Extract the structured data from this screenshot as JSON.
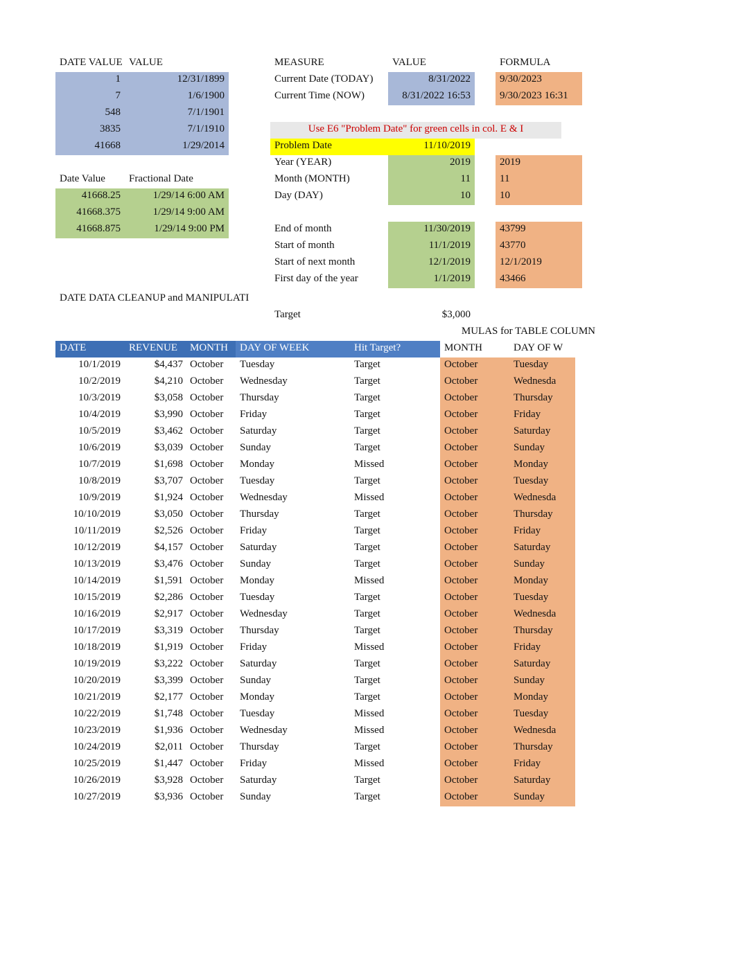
{
  "top_left": {
    "headers": [
      "DATE VALUE",
      "VALUE"
    ],
    "rows": [
      {
        "a": "1",
        "b": "12/31/1899"
      },
      {
        "a": "7",
        "b": "1/6/1900"
      },
      {
        "a": "548",
        "b": "7/1/1901"
      },
      {
        "a": "3835",
        "b": "7/1/1910"
      },
      {
        "a": "41668",
        "b": "1/29/2014"
      }
    ]
  },
  "frac": {
    "headers": [
      "Date Value",
      "Fractional Date"
    ],
    "rows": [
      {
        "a": "41668.25",
        "b": "1/29/14 6:00 AM"
      },
      {
        "a": "41668.375",
        "b": "1/29/14 9:00 AM"
      },
      {
        "a": "41668.875",
        "b": "1/29/14 9:00 PM"
      }
    ]
  },
  "top_right": {
    "headers": [
      "MEASURE",
      "VALUE",
      "FORMULA"
    ],
    "rows": [
      {
        "m": "Current Date (TODAY)",
        "v": "8/31/2022",
        "f": "9/30/2023"
      },
      {
        "m": "Current Time (NOW)",
        "v": "8/31/2022 16:53",
        "f": "9/30/2023 16:31"
      }
    ],
    "note": "Use E6 \"Problem Date\" for green cells in col. E & I",
    "problem_label": "Problem Date",
    "problem_value": "11/10/2019",
    "calc": [
      {
        "m": "Year (YEAR)",
        "v": "2019",
        "f": "2019"
      },
      {
        "m": "Month (MONTH)",
        "v": "11",
        "f": "11"
      },
      {
        "m": "Day (DAY)",
        "v": "10",
        "f": "10"
      }
    ],
    "calc2": [
      {
        "m": "End of month",
        "v": "11/30/2019",
        "f": "43799"
      },
      {
        "m": "Start of month",
        "v": "11/1/2019",
        "f": "43770"
      },
      {
        "m": "Start of next month",
        "v": "12/1/2019",
        "f": "12/1/2019"
      },
      {
        "m": "First day of the year",
        "v": "1/1/2019",
        "f": "43466"
      }
    ]
  },
  "cleanup_title": "DATE DATA CLEANUP and MANIPULATI",
  "target_label": "Target",
  "target_value": "$3,000",
  "mulas_label": "MULAS for TABLE COLUMN",
  "table": {
    "headers": [
      "DATE",
      "REVENUE",
      "MONTH",
      "DAY OF WEEK",
      "Hit Target?",
      "MONTH",
      "DAY OF W"
    ],
    "rows": [
      {
        "date": "10/1/2019",
        "rev": "$4,437",
        "mon": "October",
        "dow": "Tuesday",
        "hit": "Target",
        "mon2": "October",
        "dow2": "Tuesday"
      },
      {
        "date": "10/2/2019",
        "rev": "$4,210",
        "mon": "October",
        "dow": "Wednesday",
        "hit": "Target",
        "mon2": "October",
        "dow2": "Wednesda"
      },
      {
        "date": "10/3/2019",
        "rev": "$3,058",
        "mon": "October",
        "dow": "Thursday",
        "hit": "Target",
        "mon2": "October",
        "dow2": "Thursday"
      },
      {
        "date": "10/4/2019",
        "rev": "$3,990",
        "mon": "October",
        "dow": "Friday",
        "hit": "Target",
        "mon2": "October",
        "dow2": "Friday"
      },
      {
        "date": "10/5/2019",
        "rev": "$3,462",
        "mon": "October",
        "dow": "Saturday",
        "hit": "Target",
        "mon2": "October",
        "dow2": "Saturday"
      },
      {
        "date": "10/6/2019",
        "rev": "$3,039",
        "mon": "October",
        "dow": "Sunday",
        "hit": "Target",
        "mon2": "October",
        "dow2": "Sunday"
      },
      {
        "date": "10/7/2019",
        "rev": "$1,698",
        "mon": "October",
        "dow": "Monday",
        "hit": "Missed",
        "mon2": "October",
        "dow2": "Monday"
      },
      {
        "date": "10/8/2019",
        "rev": "$3,707",
        "mon": "October",
        "dow": "Tuesday",
        "hit": "Target",
        "mon2": "October",
        "dow2": "Tuesday"
      },
      {
        "date": "10/9/2019",
        "rev": "$1,924",
        "mon": "October",
        "dow": "Wednesday",
        "hit": "Missed",
        "mon2": "October",
        "dow2": "Wednesda"
      },
      {
        "date": "10/10/2019",
        "rev": "$3,050",
        "mon": "October",
        "dow": "Thursday",
        "hit": "Target",
        "mon2": "October",
        "dow2": "Thursday"
      },
      {
        "date": "10/11/2019",
        "rev": "$2,526",
        "mon": "October",
        "dow": "Friday",
        "hit": "Target",
        "mon2": "October",
        "dow2": "Friday"
      },
      {
        "date": "10/12/2019",
        "rev": "$4,157",
        "mon": "October",
        "dow": "Saturday",
        "hit": "Target",
        "mon2": "October",
        "dow2": "Saturday"
      },
      {
        "date": "10/13/2019",
        "rev": "$3,476",
        "mon": "October",
        "dow": "Sunday",
        "hit": "Target",
        "mon2": "October",
        "dow2": "Sunday"
      },
      {
        "date": "10/14/2019",
        "rev": "$1,591",
        "mon": "October",
        "dow": "Monday",
        "hit": "Missed",
        "mon2": "October",
        "dow2": "Monday"
      },
      {
        "date": "10/15/2019",
        "rev": "$2,286",
        "mon": "October",
        "dow": "Tuesday",
        "hit": "Target",
        "mon2": "October",
        "dow2": "Tuesday"
      },
      {
        "date": "10/16/2019",
        "rev": "$2,917",
        "mon": "October",
        "dow": "Wednesday",
        "hit": "Target",
        "mon2": "October",
        "dow2": "Wednesda"
      },
      {
        "date": "10/17/2019",
        "rev": "$3,319",
        "mon": "October",
        "dow": "Thursday",
        "hit": "Target",
        "mon2": "October",
        "dow2": "Thursday"
      },
      {
        "date": "10/18/2019",
        "rev": "$1,919",
        "mon": "October",
        "dow": "Friday",
        "hit": "Missed",
        "mon2": "October",
        "dow2": "Friday"
      },
      {
        "date": "10/19/2019",
        "rev": "$3,222",
        "mon": "October",
        "dow": "Saturday",
        "hit": "Target",
        "mon2": "October",
        "dow2": "Saturday"
      },
      {
        "date": "10/20/2019",
        "rev": "$3,399",
        "mon": "October",
        "dow": "Sunday",
        "hit": "Target",
        "mon2": "October",
        "dow2": "Sunday"
      },
      {
        "date": "10/21/2019",
        "rev": "$2,177",
        "mon": "October",
        "dow": "Monday",
        "hit": "Target",
        "mon2": "October",
        "dow2": "Monday"
      },
      {
        "date": "10/22/2019",
        "rev": "$1,748",
        "mon": "October",
        "dow": "Tuesday",
        "hit": "Missed",
        "mon2": "October",
        "dow2": "Tuesday"
      },
      {
        "date": "10/23/2019",
        "rev": "$1,936",
        "mon": "October",
        "dow": "Wednesday",
        "hit": "Missed",
        "mon2": "October",
        "dow2": "Wednesda"
      },
      {
        "date": "10/24/2019",
        "rev": "$2,011",
        "mon": "October",
        "dow": "Thursday",
        "hit": "Target",
        "mon2": "October",
        "dow2": "Thursday"
      },
      {
        "date": "10/25/2019",
        "rev": "$1,447",
        "mon": "October",
        "dow": "Friday",
        "hit": "Missed",
        "mon2": "October",
        "dow2": "Friday"
      },
      {
        "date": "10/26/2019",
        "rev": "$3,928",
        "mon": "October",
        "dow": "Saturday",
        "hit": "Target",
        "mon2": "October",
        "dow2": "Saturday"
      },
      {
        "date": "10/27/2019",
        "rev": "$3,936",
        "mon": "October",
        "dow": "Sunday",
        "hit": "Target",
        "mon2": "October",
        "dow2": "Sunday"
      }
    ]
  }
}
